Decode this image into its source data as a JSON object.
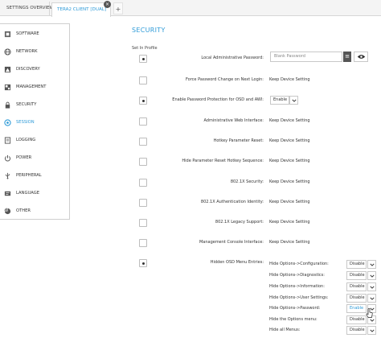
{
  "tabs": {
    "overview": "SETTINGS OVERVIEW",
    "active": "TERA2 CLIENT [DUAL]",
    "close_glyph": "×",
    "add_glyph": "+"
  },
  "sidebar": {
    "items": [
      {
        "label": "SOFTWARE",
        "icon": "software-icon"
      },
      {
        "label": "NETWORK",
        "icon": "network-icon"
      },
      {
        "label": "DISCOVERY",
        "icon": "discovery-icon"
      },
      {
        "label": "MANAGEMENT",
        "icon": "management-icon"
      },
      {
        "label": "SECURITY",
        "icon": "lock-icon"
      },
      {
        "label": "SESSION",
        "icon": "session-icon"
      },
      {
        "label": "LOGGING",
        "icon": "logging-icon"
      },
      {
        "label": "POWER",
        "icon": "power-icon"
      },
      {
        "label": "PERIPHERAL",
        "icon": "usb-icon"
      },
      {
        "label": "LANGUAGE",
        "icon": "language-icon"
      },
      {
        "label": "OTHER",
        "icon": "other-icon"
      }
    ],
    "active_index": 5
  },
  "main": {
    "title": "SECURITY",
    "set_in_profile": "Set In Profile",
    "password_placeholder": "Blank Password",
    "menu_glyph": "≡",
    "rows": [
      {
        "label": "Local Administrative Password:",
        "checked": true,
        "value": ""
      },
      {
        "label": "Force Password Change on Next Login:",
        "checked": false,
        "value": "Keep Device Setting"
      },
      {
        "label": "Enable Password Protection for OSD and AWI:",
        "checked": true,
        "value": "Enable"
      },
      {
        "label": "Administrative Web Interface:",
        "checked": false,
        "value": "Keep Device Setting"
      },
      {
        "label": "Hotkey Parameter Reset:",
        "checked": false,
        "value": "Keep Device Setting"
      },
      {
        "label": "Hide Parameter Reset Hotkey Sequence:",
        "checked": false,
        "value": "Keep Device Setting"
      },
      {
        "label": "802.1X Security:",
        "checked": false,
        "value": "Keep Device Setting"
      },
      {
        "label": "802.1X Authentication Identity:",
        "checked": false,
        "value": "Keep Device Setting"
      },
      {
        "label": "802.1X Legacy Support:",
        "checked": false,
        "value": "Keep Device Setting"
      },
      {
        "label": "Management Console Interface:",
        "checked": false,
        "value": "Keep Device Setting"
      },
      {
        "label": "Hidden OSD Menu Entries:",
        "checked": true,
        "value": ""
      }
    ],
    "osd_entries": [
      {
        "label": "Hide Options->Configuration:",
        "value": "Disable"
      },
      {
        "label": "Hide Options->Diagnostics:",
        "value": "Disable"
      },
      {
        "label": "Hide Options->Information:",
        "value": "Disable"
      },
      {
        "label": "Hide Options->User Settings:",
        "value": "Disable"
      },
      {
        "label": "Hide Options->Password:",
        "value": "Enable"
      },
      {
        "label": "Hide the Options menu:",
        "value": "Disable"
      },
      {
        "label": "Hide all Menus:",
        "value": "Disable"
      }
    ]
  },
  "colors": {
    "accent": "#2f9bd8",
    "border": "#c8c8c8",
    "text": "#333333"
  }
}
